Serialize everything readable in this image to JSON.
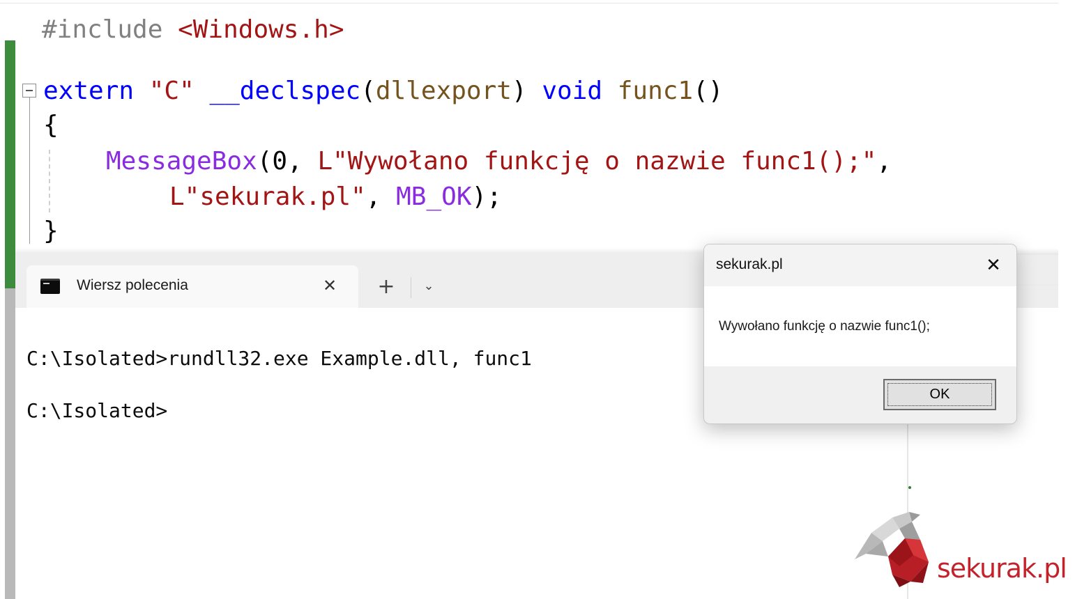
{
  "code": {
    "line1": {
      "directive": "#include",
      "header": "<Windows.h>"
    },
    "line2": {
      "extern": "extern",
      "linkage": "\"C\"",
      "declspec": "__declspec",
      "open": "(",
      "export": "dllexport",
      "close": ")",
      "void": "void",
      "fname": "func1",
      "parens": "()"
    },
    "line3": {
      "text": "{"
    },
    "line4": {
      "call": "MessageBox",
      "open": "(0, ",
      "str": "L\"Wywołano funkcję o nazwie func1();\"",
      "comma": ","
    },
    "line5": {
      "str": "L\"sekurak.pl\"",
      "sep": ", ",
      "macro": "MB_OK",
      "end": ");"
    },
    "line6": {
      "text": "}"
    }
  },
  "terminal": {
    "tab_label": "Wiersz polecenia",
    "tab_close": "✕",
    "new_tab": "+",
    "dropdown": "⌄",
    "lines": [
      "C:\\Isolated>rundll32.exe Example.dll, func1",
      "C:\\Isolated>"
    ]
  },
  "messagebox": {
    "title": "sekurak.pl",
    "close": "✕",
    "message": "Wywołano funkcję o nazwie func1();",
    "ok_label": "OK"
  },
  "logo": {
    "text": "sekurak.pl"
  },
  "colors": {
    "preprocessor": "#808080",
    "string": "#a31515",
    "keyword": "#0000ff",
    "function": "#74531f",
    "macro": "#8a2be2",
    "change_bar": "#3d8c3d",
    "logo_red": "#c4222b"
  },
  "icons": {
    "fold": "collapse-minus-icon",
    "terminal": "command-prompt-icon",
    "close": "close-icon",
    "add": "plus-icon",
    "dropdown": "chevron-down-icon",
    "logo": "sekurak-bird-icon"
  }
}
